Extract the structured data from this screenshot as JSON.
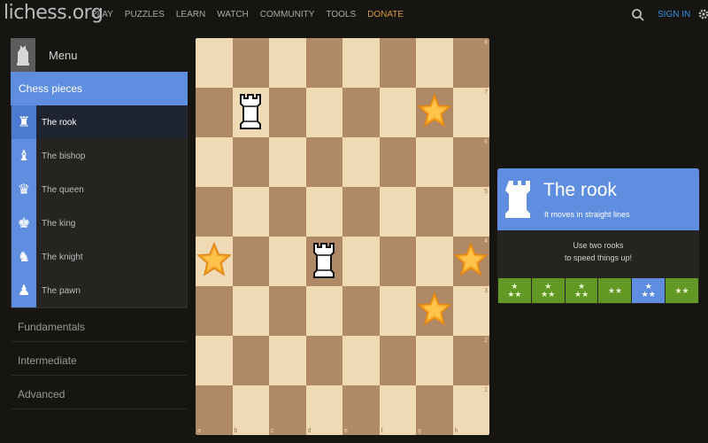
{
  "header": {
    "logo": "lichess.org",
    "nav": [
      "PLAY",
      "PUZZLES",
      "LEARN",
      "WATCH",
      "COMMUNITY",
      "TOOLS",
      "DONATE"
    ],
    "signin": "SIGN IN"
  },
  "sidebar": {
    "menu_title": "Menu",
    "section": "Chess pieces",
    "stages": [
      {
        "label": "The rook",
        "icon": "rook-icon",
        "glyph": "♜"
      },
      {
        "label": "The bishop",
        "icon": "bishop-icon",
        "glyph": "♝"
      },
      {
        "label": "The queen",
        "icon": "queen-icon",
        "glyph": "♛"
      },
      {
        "label": "The king",
        "icon": "king-icon",
        "glyph": "♚"
      },
      {
        "label": "The knight",
        "icon": "knight-icon",
        "glyph": "♞"
      },
      {
        "label": "The pawn",
        "icon": "pawn-icon",
        "glyph": "♟"
      }
    ],
    "categories": [
      "Fundamentals",
      "Intermediate",
      "Advanced"
    ]
  },
  "board": {
    "ranks": [
      "8",
      "7",
      "6",
      "5",
      "4",
      "3",
      "2",
      "1"
    ],
    "files": [
      "a",
      "b",
      "c",
      "d",
      "e",
      "f",
      "g",
      "h"
    ],
    "rooks": [
      "b7",
      "d4"
    ],
    "stars": [
      "g7",
      "a4",
      "h4",
      "g3"
    ]
  },
  "card": {
    "title": "The rook",
    "subtitle": "It moves in straight lines",
    "text_line1": "Use two rooks",
    "text_line2": "to speed things up!",
    "levels": [
      {
        "stars": [
          "★",
          "★★"
        ],
        "current": false
      },
      {
        "stars": [
          "★",
          "★★"
        ],
        "current": false
      },
      {
        "stars": [
          "★",
          "★★"
        ],
        "current": false
      },
      {
        "stars": [
          "★★"
        ],
        "current": false
      },
      {
        "stars": [
          "★",
          "★★"
        ],
        "current": true
      },
      {
        "stars": [
          "★★"
        ],
        "current": false
      }
    ]
  },
  "colors": {
    "accent": "#5f8ee0",
    "light_square": "#efdab5",
    "dark_square": "#b08a66",
    "level_done": "#629924",
    "donate": "#d69a3a",
    "signin": "#3692e7"
  }
}
